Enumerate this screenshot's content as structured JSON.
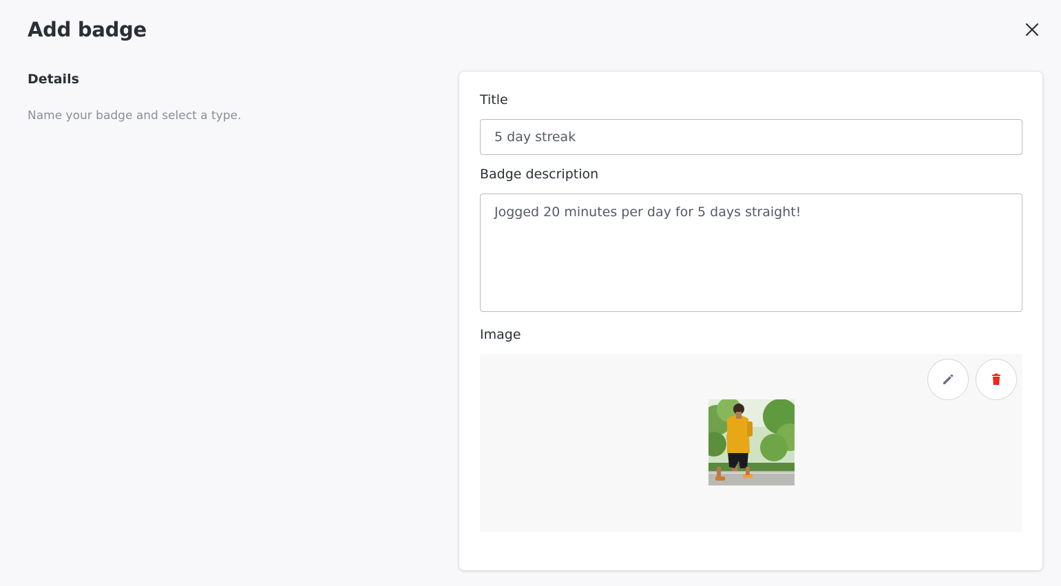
{
  "dialog": {
    "title": "Add badge",
    "close_icon": "close-icon"
  },
  "details": {
    "heading": "Details",
    "description": "Name your badge and select a type."
  },
  "form": {
    "title_label": "Title",
    "title_value": "5 day streak",
    "description_label": "Badge description",
    "description_value": "Jogged 20 minutes per day for 5 days straight!",
    "image_label": "Image",
    "edit_icon": "pencil-icon",
    "delete_icon": "trash-icon"
  },
  "colors": {
    "delete": "#e8291c",
    "edit": "#6b7280",
    "shirt": "#e8a717"
  }
}
